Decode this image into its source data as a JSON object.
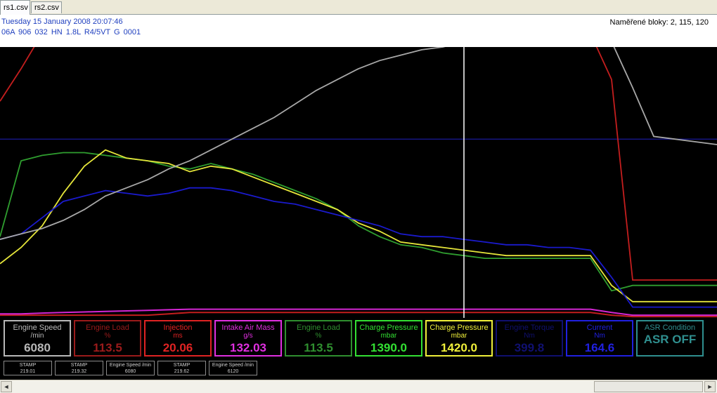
{
  "tabs": [
    {
      "label": "rs1.csv",
      "active": true
    },
    {
      "label": "rs2.csv",
      "active": false
    }
  ],
  "header": {
    "date_line": "Tuesday 15 January 2008 20:07:46",
    "ecu_line": "06A 906 032 HN  1.8L R4/5VT    G   0001",
    "blocks": "Naměřené bloky: 2, 115, 120"
  },
  "chart_data": {
    "type": "line",
    "x": [
      0,
      30,
      60,
      90,
      120,
      150,
      180,
      210,
      240,
      270,
      300,
      330,
      360,
      390,
      420,
      450,
      480,
      510,
      540,
      570,
      600,
      630,
      660,
      690,
      720,
      750,
      780,
      810,
      840,
      870,
      900,
      930,
      960,
      990,
      1020
    ],
    "cursor_x": 660,
    "reference_level": 0.66,
    "series": [
      {
        "color": "#2f9e2f",
        "values": [
          0.3,
          0.58,
          0.6,
          0.61,
          0.61,
          0.6,
          0.59,
          0.58,
          0.56,
          0.55,
          0.57,
          0.55,
          0.53,
          0.5,
          0.47,
          0.44,
          0.4,
          0.34,
          0.3,
          0.27,
          0.26,
          0.24,
          0.23,
          0.22,
          0.22,
          0.22,
          0.22,
          0.22,
          0.22,
          0.1,
          0.12,
          0.12,
          0.12,
          0.12,
          0.12
        ]
      },
      {
        "color": "#e6e63a",
        "values": [
          0.2,
          0.26,
          0.34,
          0.46,
          0.56,
          0.62,
          0.59,
          0.58,
          0.57,
          0.54,
          0.56,
          0.55,
          0.52,
          0.49,
          0.46,
          0.43,
          0.4,
          0.35,
          0.32,
          0.28,
          0.27,
          0.26,
          0.25,
          0.24,
          0.23,
          0.23,
          0.23,
          0.23,
          0.23,
          0.12,
          0.06,
          0.06,
          0.06,
          0.06,
          0.06
        ]
      },
      {
        "color": "#1a1acc",
        "values": [
          0.29,
          0.31,
          0.37,
          0.43,
          0.45,
          0.47,
          0.46,
          0.45,
          0.46,
          0.48,
          0.48,
          0.47,
          0.45,
          0.43,
          0.42,
          0.4,
          0.38,
          0.36,
          0.34,
          0.31,
          0.3,
          0.3,
          0.29,
          0.28,
          0.27,
          0.27,
          0.26,
          0.26,
          0.25,
          0.15,
          0.04,
          0.04,
          0.04,
          0.04,
          0.04
        ]
      },
      {
        "color": "#a8a8a8",
        "values": [
          0.29,
          0.31,
          0.33,
          0.36,
          0.4,
          0.45,
          0.48,
          0.51,
          0.55,
          0.58,
          0.62,
          0.66,
          0.7,
          0.74,
          0.79,
          0.84,
          0.88,
          0.92,
          0.95,
          0.97,
          0.99,
          1.0,
          1.02,
          1.02,
          1.02,
          1.02,
          1.02,
          1.02,
          1.02,
          1.02,
          0.85,
          0.67,
          0.66,
          0.65,
          0.64
        ]
      },
      {
        "color": "#c41e1e",
        "values": [
          0.8,
          0.92,
          1.05,
          1.05,
          1.05,
          1.05,
          1.05,
          1.05,
          1.05,
          1.05,
          1.05,
          1.05,
          1.05,
          1.05,
          1.05,
          1.05,
          1.05,
          1.05,
          1.05,
          1.05,
          1.05,
          1.05,
          1.05,
          1.05,
          1.05,
          1.05,
          1.05,
          1.05,
          1.05,
          0.88,
          0.14,
          0.14,
          0.14,
          0.14,
          0.14
        ]
      },
      {
        "color": "#c41e1e",
        "values": [
          0.01,
          0.01,
          0.01,
          0.01,
          0.01,
          0.01,
          0.01,
          0.01,
          0.015,
          0.02,
          0.02,
          0.02,
          0.02,
          0.02,
          0.02,
          0.02,
          0.02,
          0.02,
          0.02,
          0.02,
          0.02,
          0.02,
          0.02,
          0.02,
          0.02,
          0.02,
          0.02,
          0.02,
          0.02,
          0.01,
          0.005,
          0.005,
          0.005,
          0.005,
          0.005
        ]
      },
      {
        "color": "#d426d4",
        "values": [
          0.015,
          0.015,
          0.018,
          0.02,
          0.022,
          0.024,
          0.026,
          0.028,
          0.03,
          0.032,
          0.032,
          0.032,
          0.032,
          0.032,
          0.032,
          0.032,
          0.032,
          0.032,
          0.032,
          0.032,
          0.032,
          0.032,
          0.032,
          0.032,
          0.032,
          0.032,
          0.032,
          0.032,
          0.032,
          0.02,
          0.01,
          0.01,
          0.01,
          0.01,
          0.01
        ]
      }
    ]
  },
  "panels": [
    {
      "name": "Engine Speed",
      "unit": "/min",
      "value": "6080",
      "color": "#b8b8b8"
    },
    {
      "name": "Engine Load",
      "unit": "%",
      "value": "113.5",
      "color": "#9b1b1b"
    },
    {
      "name": "Injection",
      "unit": "ms",
      "value": "20.06",
      "color": "#e02323"
    },
    {
      "name": "Intake Air Mass",
      "unit": "g/s",
      "value": "132.03",
      "color": "#e02fe0"
    },
    {
      "name": "Engine Load",
      "unit": "%",
      "value": "113.5",
      "color": "#2f8f2f"
    },
    {
      "name": "Charge Pressure",
      "unit": "mbar",
      "value": "1390.0",
      "color": "#33e033"
    },
    {
      "name": "Charge Pressure",
      "unit": "mbar",
      "value": "1420.0",
      "color": "#f0f03a"
    },
    {
      "name": "Engine Torque",
      "unit": "Nm",
      "value": "399.8",
      "color": "#101070"
    },
    {
      "name": "Current",
      "unit": "Nm",
      "value": "164.6",
      "color": "#2020e0"
    },
    {
      "name": "ASR Condition",
      "unit": "",
      "value": "ASR OFF",
      "color": "#2f8f8f"
    }
  ],
  "stamps": [
    {
      "label": "STAMP",
      "value": "219.01"
    },
    {
      "label": "STAMP",
      "value": "219.32"
    },
    {
      "label": "Engine Speed /min",
      "value": "6080"
    },
    {
      "label": "STAMP",
      "value": "219.62"
    },
    {
      "label": "Engine Speed /min",
      "value": "6120"
    }
  ],
  "scrollbar": {
    "left_arrow": "◄",
    "right_arrow": "►"
  }
}
